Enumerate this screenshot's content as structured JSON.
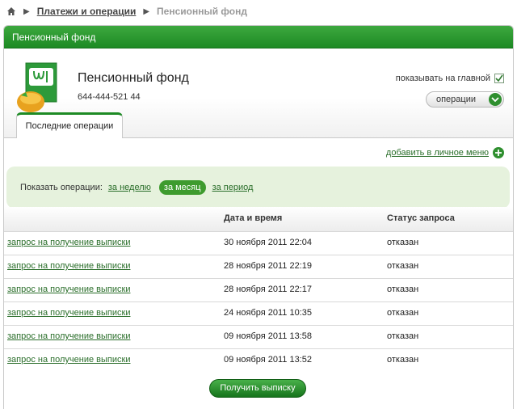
{
  "breadcrumb": {
    "items": [
      "Платежи и операции",
      "Пенсионный фонд"
    ]
  },
  "panel": {
    "header_title": "Пенсионный фонд",
    "title": "Пенсионный фонд",
    "account": "644-444-521 44",
    "show_on_main_label": "показывать на главной",
    "show_on_main_checked": true,
    "operations_button": "операции",
    "tab_label": "Последние операции",
    "add_menu_label": "добавить в личное меню"
  },
  "filter": {
    "label": "Показать операции:",
    "options": [
      "за неделю",
      "за месяц",
      "за период"
    ],
    "selected": "за месяц"
  },
  "table": {
    "headers": [
      "",
      "Дата и время",
      "Статус запроса"
    ],
    "rows": [
      {
        "name": "запрос на получение выписки",
        "datetime": "30 ноября 2011  22:04",
        "status": "отказан"
      },
      {
        "name": "запрос на получение выписки",
        "datetime": "28 ноября 2011  22:19",
        "status": "отказан"
      },
      {
        "name": "запрос на получение выписки",
        "datetime": "28 ноября 2011  22:17",
        "status": "отказан"
      },
      {
        "name": "запрос на получение выписки",
        "datetime": "24 ноября 2011  10:35",
        "status": "отказан"
      },
      {
        "name": "запрос на получение выписки",
        "datetime": "09 ноября 2011  13:58",
        "status": "отказан"
      },
      {
        "name": "запрос на получение выписки",
        "datetime": "09 ноября 2011  13:52",
        "status": "отказан"
      }
    ]
  },
  "get_statement_button": "Получить выписку",
  "colors": {
    "brand_green": "#1d8a24",
    "link_green": "#2a6e2a",
    "filter_bg": "#e6f2dd"
  },
  "icons": {
    "home": "home-icon",
    "logo": "pension-fund-logo",
    "checkbox": "checkmark-icon",
    "operations": "chevron-down-icon",
    "add": "plus-icon"
  }
}
